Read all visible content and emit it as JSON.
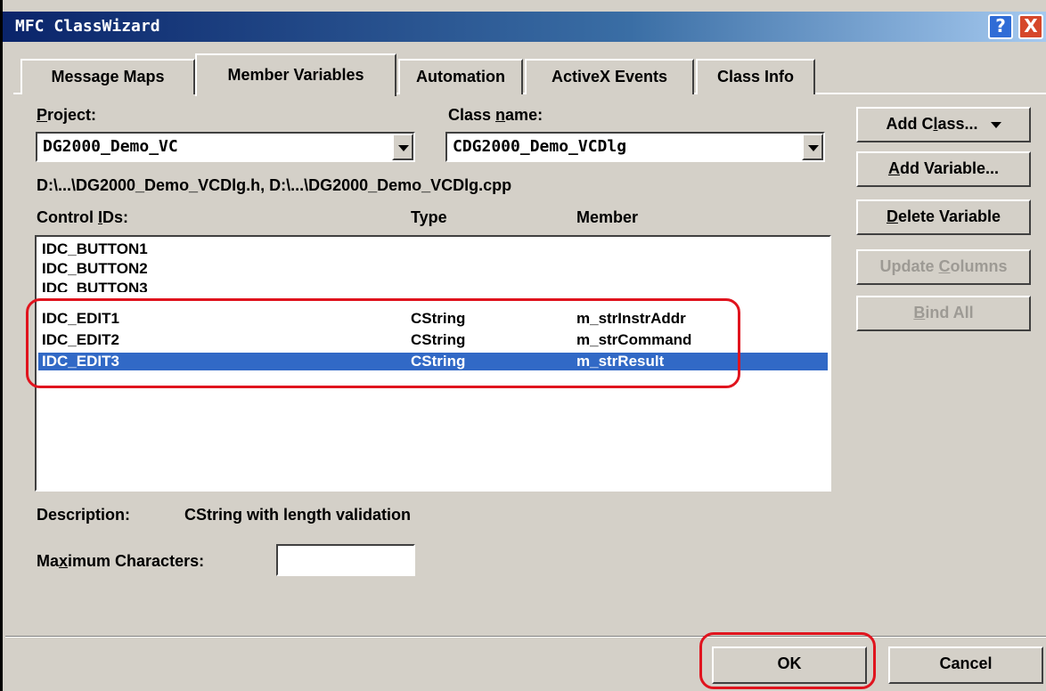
{
  "window": {
    "title": "MFC ClassWizard",
    "help_label": "?",
    "close_label": "X"
  },
  "tabs": [
    {
      "label": "Message Maps",
      "active": false
    },
    {
      "label": "Member Variables",
      "active": true
    },
    {
      "label": "Automation",
      "active": false
    },
    {
      "label": "ActiveX Events",
      "active": false
    },
    {
      "label": "Class Info",
      "active": false
    }
  ],
  "project": {
    "label_prefix": "",
    "label_hotkey": "P",
    "label_rest": "roject:",
    "value": "DG2000_Demo_VC"
  },
  "classname": {
    "label_prefix": "Class ",
    "label_hotkey": "n",
    "label_rest": "ame:",
    "value": "CDG2000_Demo_VCDlg"
  },
  "files_path": "D:\\...\\DG2000_Demo_VCDlg.h, D:\\...\\DG2000_Demo_VCDlg.cpp",
  "columns": {
    "control_ids_prefix": "Control ",
    "control_ids_hotkey": "I",
    "control_ids_rest": "Ds:",
    "type": "Type",
    "member": "Member"
  },
  "rows": [
    {
      "id": "IDC_BUTTON1",
      "type": "",
      "member": "",
      "selected": false
    },
    {
      "id": "IDC_BUTTON2",
      "type": "",
      "member": "",
      "selected": false
    },
    {
      "id": "IDC_BUTTON3",
      "type": "",
      "member": "",
      "selected": false
    },
    {
      "id": "IDC_EDIT1",
      "type": "CString",
      "member": "m_strInstrAddr",
      "selected": false
    },
    {
      "id": "IDC_EDIT2",
      "type": "CString",
      "member": "m_strCommand",
      "selected": false
    },
    {
      "id": "IDC_EDIT3",
      "type": "CString",
      "member": "m_strResult",
      "selected": true
    }
  ],
  "buttons": {
    "add_class": {
      "prefix": "Add C",
      "hotkey": "l",
      "rest": "ass..."
    },
    "add_variable": {
      "prefix": "",
      "hotkey": "A",
      "rest": "dd Variable..."
    },
    "delete_variable": {
      "prefix": "",
      "hotkey": "D",
      "rest": "elete Variable"
    },
    "update_columns": {
      "prefix": "Update ",
      "hotkey": "C",
      "rest": "olumns"
    },
    "bind_all": {
      "prefix": "",
      "hotkey": "B",
      "rest": "ind All"
    },
    "ok": "OK",
    "cancel": "Cancel"
  },
  "description": {
    "label": "Description:",
    "value": "CString with length validation"
  },
  "max_chars": {
    "prefix": "Ma",
    "hotkey": "x",
    "rest": "imum Characters:",
    "value": ""
  },
  "colors": {
    "selection": "#3169c6",
    "highlight_box": "#e0141e",
    "face": "#d4d0c8"
  }
}
